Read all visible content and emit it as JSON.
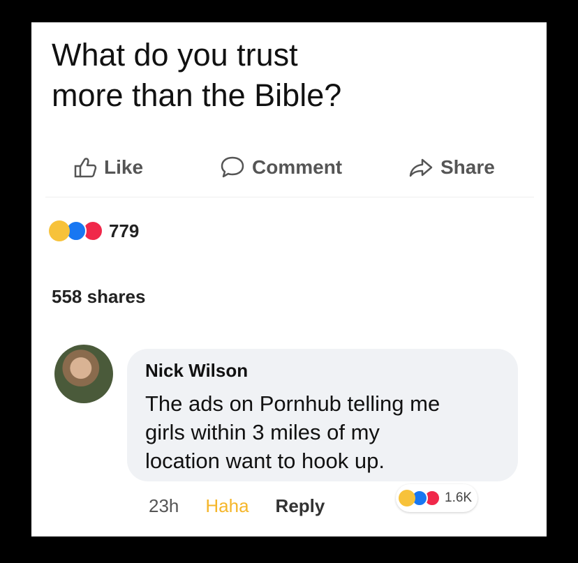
{
  "post": {
    "text_line1": "What do you trust",
    "text_line2": "more than the Bible?"
  },
  "actions": {
    "like": {
      "label": "Like",
      "icon": "thumbs-up-icon"
    },
    "comment": {
      "label": "Comment",
      "icon": "speech-bubble-icon"
    },
    "share": {
      "label": "Share",
      "icon": "share-arrow-icon"
    }
  },
  "reactions": {
    "icons": [
      "haha",
      "like",
      "love"
    ],
    "count": "779"
  },
  "shares": "558 shares",
  "comment": {
    "author": "Nick Wilson",
    "text_line1": "The ads on Pornhub telling me",
    "text_line2": "girls within 3 miles of my",
    "text_line3": "location want to hook up.",
    "time": "23h",
    "reaction_label": "Haha",
    "reply_label": "Reply",
    "reaction_count": "1.6K"
  },
  "colors": {
    "haha": "#f7c23a",
    "like": "#1877f2",
    "love": "#f0284a",
    "haha_text": "#f5b62a"
  }
}
